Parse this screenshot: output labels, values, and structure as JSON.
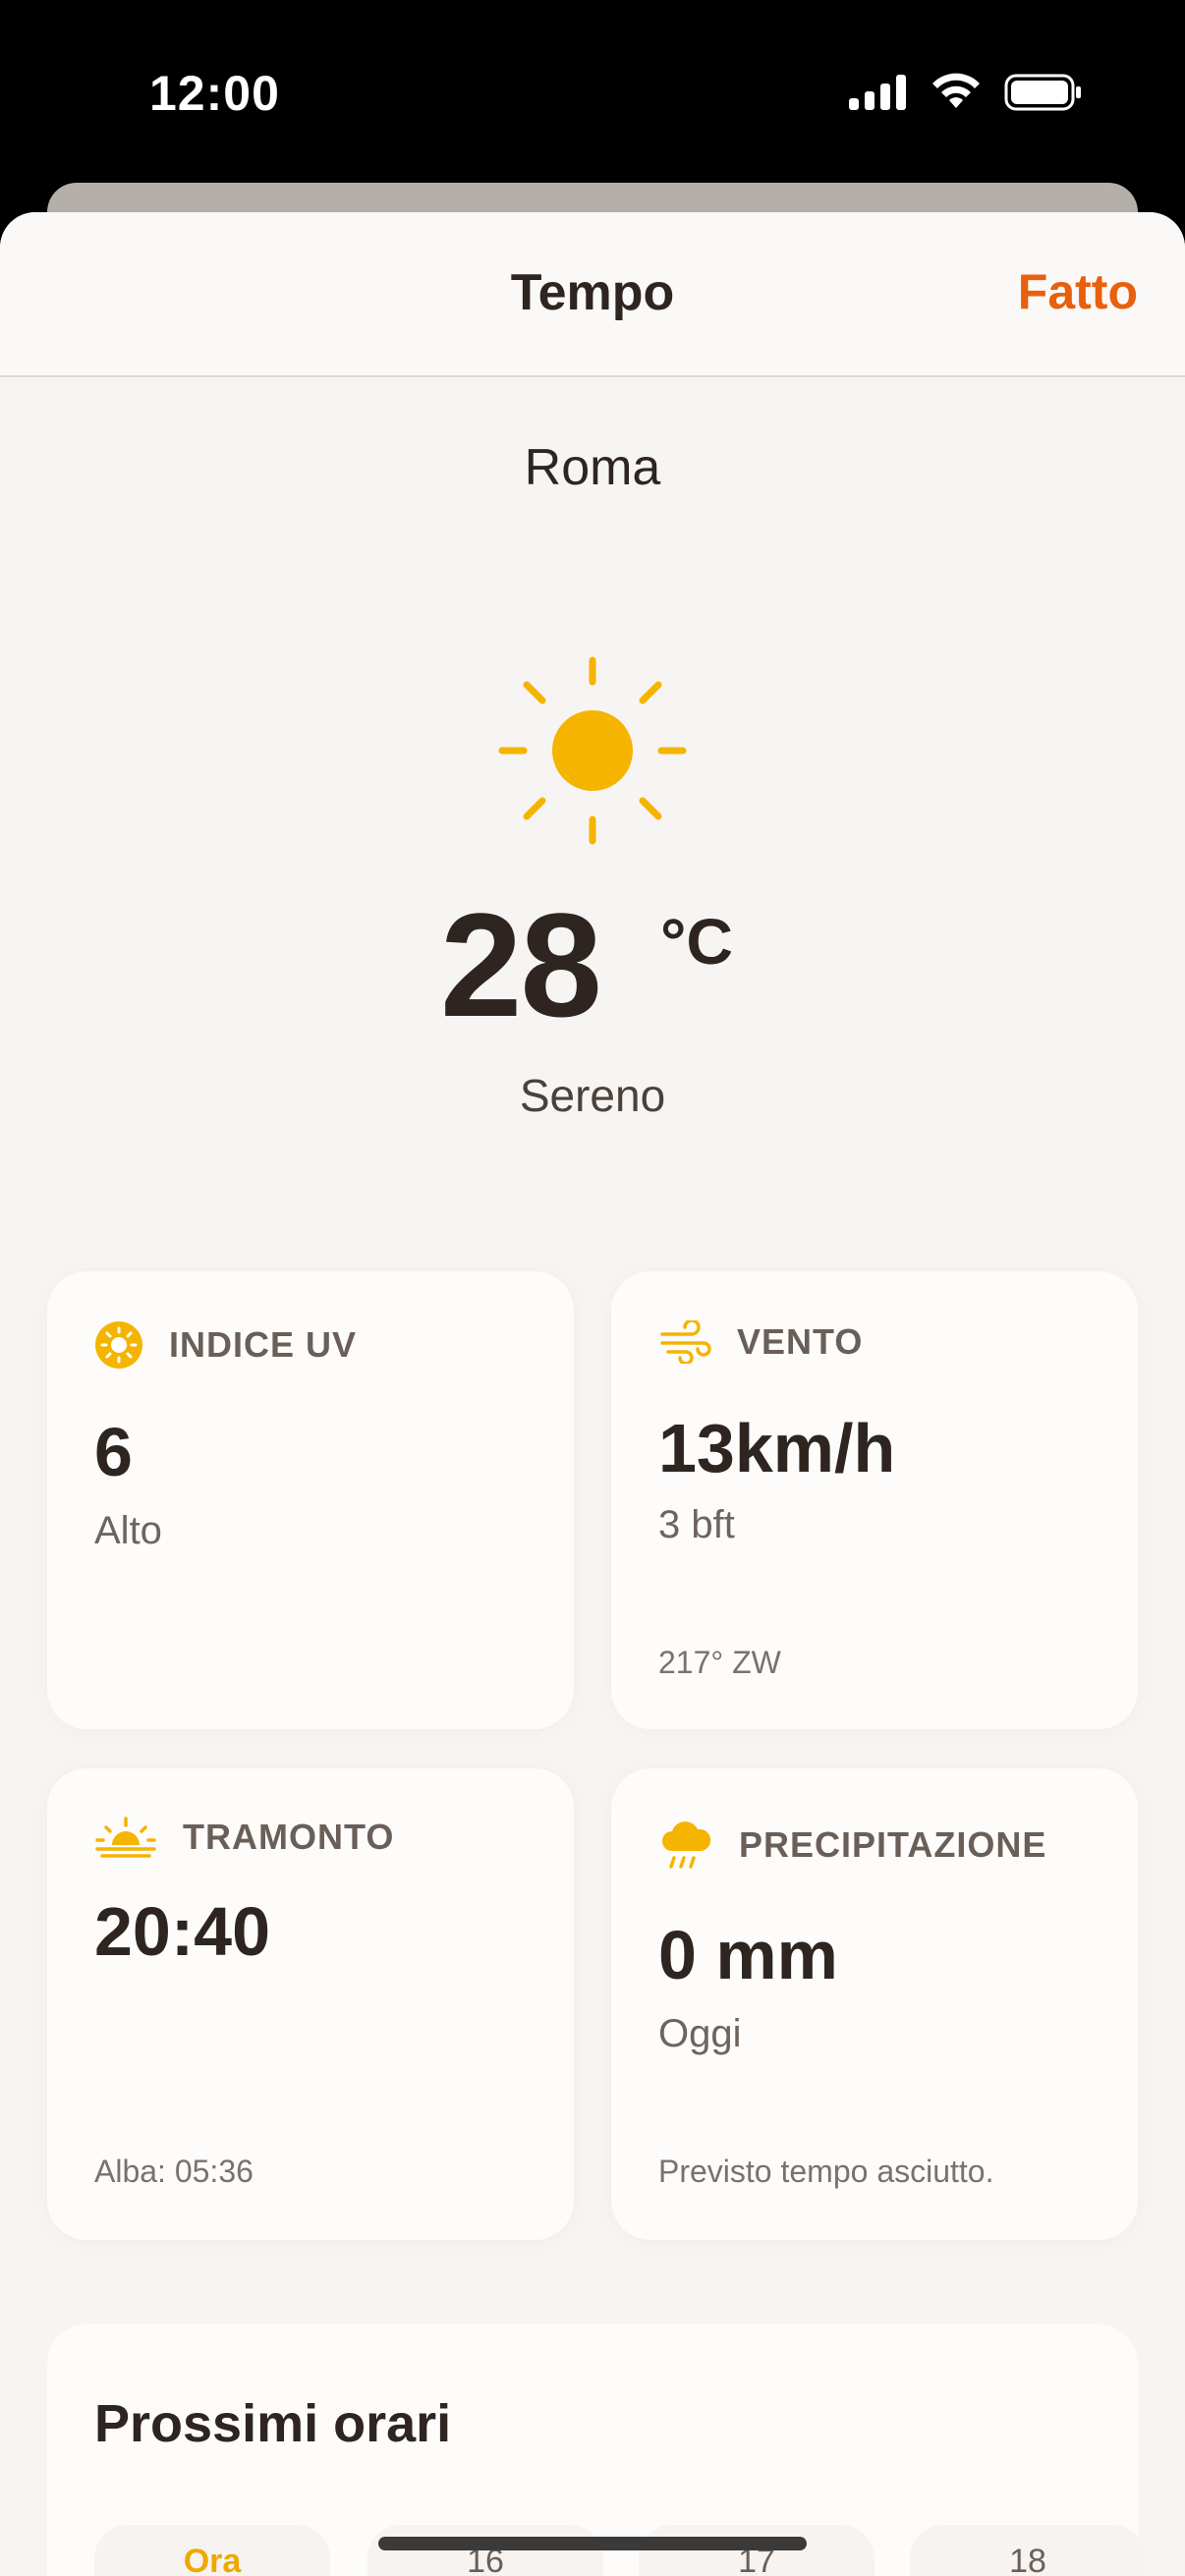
{
  "status_bar": {
    "time": "12:00"
  },
  "nav": {
    "title": "Tempo",
    "done_label": "Fatto"
  },
  "location": {
    "city": "Roma"
  },
  "current": {
    "temperature": "28",
    "unit": "°C",
    "condition": "Sereno",
    "icon": "sun-icon"
  },
  "cards": {
    "uv": {
      "label": "INDICE UV",
      "value": "6",
      "sub": "Alto",
      "icon": "uv-sun-icon"
    },
    "wind": {
      "label": "VENTO",
      "value": "13km/h",
      "sub": "3 bft",
      "note": "217° ZW",
      "icon": "wind-icon"
    },
    "sunset": {
      "label": "TRAMONTO",
      "value": "20:40",
      "note": "Alba: 05:36",
      "icon": "sunset-icon"
    },
    "precip": {
      "label": "PRECIPITAZIONE",
      "value": "0 mm",
      "sub": "Oggi",
      "note": "Previsto tempo asciutto.",
      "icon": "rain-cloud-icon"
    }
  },
  "hourly": {
    "title": "Prossimi orari",
    "hours": [
      "Ora",
      "16",
      "17",
      "18"
    ]
  },
  "colors": {
    "accent": "#e8600e",
    "sun": "#f5b400",
    "background": "#f7f5f3"
  }
}
